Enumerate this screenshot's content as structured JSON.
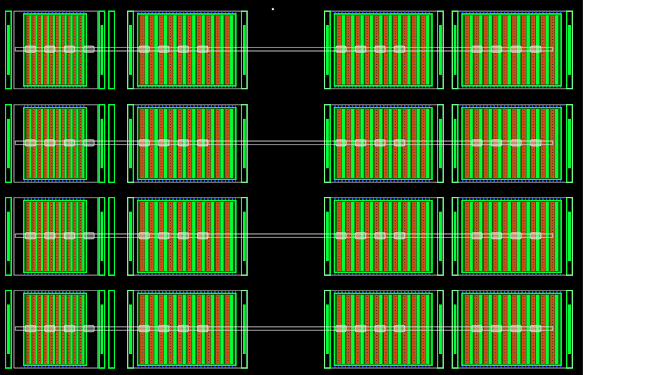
{
  "layout": {
    "rows": 4,
    "blocks_per_row": 4,
    "fingers_per_block": 10,
    "contacts_per_bus_segment": 4
  },
  "colors": {
    "background": "#000000",
    "diffusion": "#22dd22",
    "poly": "#c8501a",
    "metal_outline": "#d0d0d0",
    "guard_ring": "#00ff33",
    "well_dots": "#1a4cff",
    "bus": "#e8e8e8"
  }
}
